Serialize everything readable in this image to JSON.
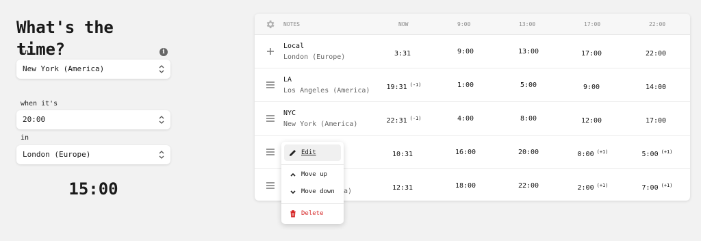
{
  "app": {
    "title": "What's the time?"
  },
  "form": {
    "in_label": "in",
    "in_value": "New York (America)",
    "when_label": "when it's",
    "when_value": "20:00",
    "to_label": "in",
    "to_value": "London (Europe)",
    "result": "15:00"
  },
  "table": {
    "headers": {
      "notes": "NOTES",
      "now": "NOW",
      "h1": "9:00",
      "h2": "13:00",
      "h3": "17:00",
      "h4": "22:00"
    },
    "rows": [
      {
        "name": "Local",
        "zone": "London (Europe)",
        "now": "3:31",
        "now_offset": "",
        "c1": "9:00",
        "c2": "13:00",
        "c3": "17:00",
        "c3_offset": "",
        "c4": "22:00",
        "c4_offset": "",
        "icon": "plus-icon"
      },
      {
        "name": "LA",
        "zone": "Los Angeles (America)",
        "now": "19:31",
        "now_offset": "(-1)",
        "c1": "1:00",
        "c2": "5:00",
        "c3": "9:00",
        "c3_offset": "",
        "c4": "14:00",
        "c4_offset": "",
        "icon": "drag-handle-icon"
      },
      {
        "name": "NYC",
        "zone": "New York (America)",
        "now": "22:31",
        "now_offset": "(-1)",
        "c1": "4:00",
        "c2": "8:00",
        "c3": "12:00",
        "c3_offset": "",
        "c4": "17:00",
        "c4_offset": "",
        "icon": "drag-handle-icon"
      },
      {
        "name": "",
        "zone": "",
        "now": "10:31",
        "now_offset": "",
        "c1": "16:00",
        "c2": "20:00",
        "c3": "0:00",
        "c3_offset": "(+1)",
        "c4": "5:00",
        "c4_offset": "(+1)",
        "icon": "drag-handle-icon"
      },
      {
        "name": "",
        "zone": "a)",
        "now": "12:31",
        "now_offset": "",
        "c1": "18:00",
        "c2": "22:00",
        "c3": "2:00",
        "c3_offset": "(+1)",
        "c4": "7:00",
        "c4_offset": "(+1)",
        "icon": "drag-handle-icon"
      }
    ]
  },
  "menu": {
    "edit": "Edit",
    "move_up": "Move up",
    "move_down": "Move down",
    "delete": "Delete",
    "delete_color": "#d62828"
  }
}
